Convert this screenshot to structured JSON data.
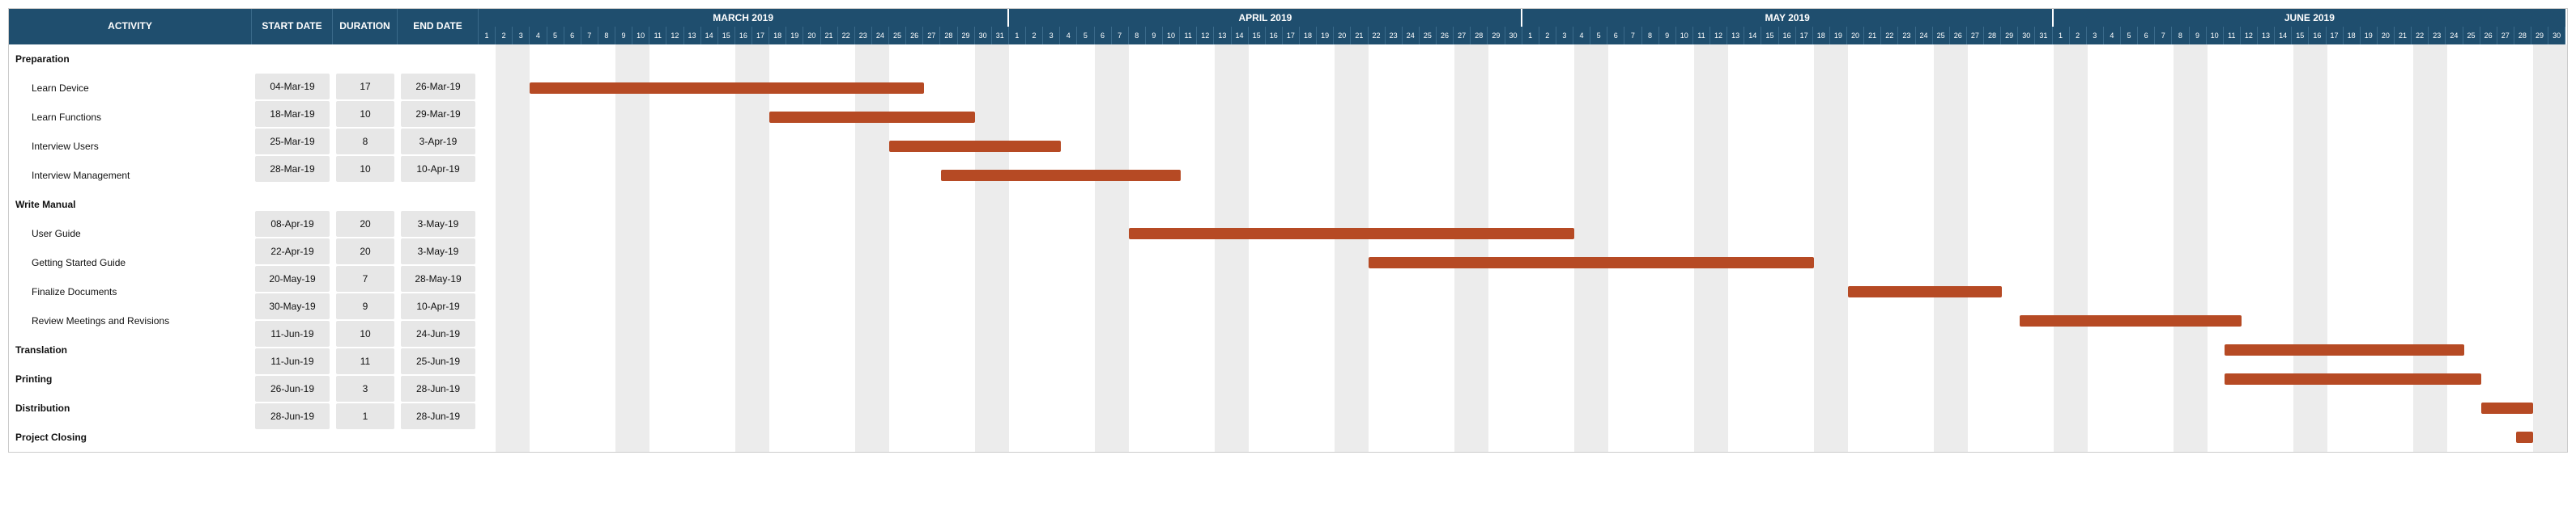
{
  "headers": {
    "activity": "ACTIVITY",
    "start": "START DATE",
    "duration": "DURATION",
    "end": "END DATE"
  },
  "months": [
    {
      "label": "MARCH 2019",
      "days": 31,
      "start_day": 1
    },
    {
      "label": "APRIL 2019",
      "days": 30,
      "start_day": 1
    },
    {
      "label": "MAY 2019",
      "days": 31,
      "start_day": 1
    },
    {
      "label": "JUNE 2019",
      "days": 30,
      "start_day": 1
    }
  ],
  "rows": [
    {
      "type": "phase",
      "activity": "Preparation",
      "start": "",
      "duration": "",
      "end": ""
    },
    {
      "type": "task",
      "activity": "Learn Device",
      "start": "04-Mar-19",
      "duration": "17",
      "end": "26-Mar-19",
      "bar_start": 3,
      "bar_span": 23
    },
    {
      "type": "task",
      "activity": "Learn Functions",
      "start": "18-Mar-19",
      "duration": "10",
      "end": "29-Mar-19",
      "bar_start": 17,
      "bar_span": 12
    },
    {
      "type": "task",
      "activity": "Interview Users",
      "start": "25-Mar-19",
      "duration": "8",
      "end": "3-Apr-19",
      "bar_start": 24,
      "bar_span": 10
    },
    {
      "type": "task",
      "activity": "Interview Management",
      "start": "28-Mar-19",
      "duration": "10",
      "end": "10-Apr-19",
      "bar_start": 27,
      "bar_span": 14
    },
    {
      "type": "phase",
      "activity": "Write Manual",
      "start": "",
      "duration": "",
      "end": ""
    },
    {
      "type": "task",
      "activity": "User Guide",
      "start": "08-Apr-19",
      "duration": "20",
      "end": "3-May-19",
      "bar_start": 38,
      "bar_span": 26
    },
    {
      "type": "task",
      "activity": "Getting Started Guide",
      "start": "22-Apr-19",
      "duration": "20",
      "end": "3-May-19",
      "bar_start": 52,
      "bar_span": 26
    },
    {
      "type": "task",
      "activity": "Finalize Documents",
      "start": "20-May-19",
      "duration": "7",
      "end": "28-May-19",
      "bar_start": 80,
      "bar_span": 9
    },
    {
      "type": "task",
      "activity": "Review Meetings and Revisions",
      "start": "30-May-19",
      "duration": "9",
      "end": "10-Apr-19",
      "bar_start": 90,
      "bar_span": 13
    },
    {
      "type": "phase",
      "activity": "Translation",
      "start": "11-Jun-19",
      "duration": "10",
      "end": "24-Jun-19",
      "bar_start": 102,
      "bar_span": 14
    },
    {
      "type": "phase",
      "activity": "Printing",
      "start": "11-Jun-19",
      "duration": "11",
      "end": "25-Jun-19",
      "bar_start": 102,
      "bar_span": 15
    },
    {
      "type": "phase",
      "activity": "Distribution",
      "start": "26-Jun-19",
      "duration": "3",
      "end": "28-Jun-19",
      "bar_start": 117,
      "bar_span": 3
    },
    {
      "type": "phase",
      "activity": "Project Closing",
      "start": "28-Jun-19",
      "duration": "1",
      "end": "28-Jun-19",
      "bar_start": 119,
      "bar_span": 1
    }
  ],
  "colors": {
    "header_bg": "#1f4e6e",
    "bar": "#b64a24",
    "stripe": "#ececec"
  },
  "chart_data": {
    "type": "bar",
    "title": "Project Gantt Chart March–June 2019",
    "xlabel": "Date",
    "ylabel": "Activity",
    "x_range": [
      "2019-03-01",
      "2019-06-30"
    ],
    "tasks": [
      {
        "name": "Learn Device",
        "group": "Preparation",
        "start": "2019-03-04",
        "end": "2019-03-26",
        "duration_days": 17
      },
      {
        "name": "Learn Functions",
        "group": "Preparation",
        "start": "2019-03-18",
        "end": "2019-03-29",
        "duration_days": 10
      },
      {
        "name": "Interview Users",
        "group": "Preparation",
        "start": "2019-03-25",
        "end": "2019-04-03",
        "duration_days": 8
      },
      {
        "name": "Interview Management",
        "group": "Preparation",
        "start": "2019-03-28",
        "end": "2019-04-10",
        "duration_days": 10
      },
      {
        "name": "User Guide",
        "group": "Write Manual",
        "start": "2019-04-08",
        "end": "2019-05-03",
        "duration_days": 20
      },
      {
        "name": "Getting Started Guide",
        "group": "Write Manual",
        "start": "2019-04-22",
        "end": "2019-05-17",
        "duration_days": 20
      },
      {
        "name": "Finalize Documents",
        "group": "Write Manual",
        "start": "2019-05-20",
        "end": "2019-05-28",
        "duration_days": 7
      },
      {
        "name": "Review Meetings and Revisions",
        "group": "Write Manual",
        "start": "2019-05-30",
        "end": "2019-06-11",
        "duration_days": 9
      },
      {
        "name": "Translation",
        "group": "Translation",
        "start": "2019-06-11",
        "end": "2019-06-24",
        "duration_days": 10
      },
      {
        "name": "Printing",
        "group": "Printing",
        "start": "2019-06-11",
        "end": "2019-06-25",
        "duration_days": 11
      },
      {
        "name": "Distribution",
        "group": "Distribution",
        "start": "2019-06-26",
        "end": "2019-06-28",
        "duration_days": 3
      },
      {
        "name": "Project Closing",
        "group": "Project Closing",
        "start": "2019-06-28",
        "end": "2019-06-28",
        "duration_days": 1
      }
    ]
  }
}
